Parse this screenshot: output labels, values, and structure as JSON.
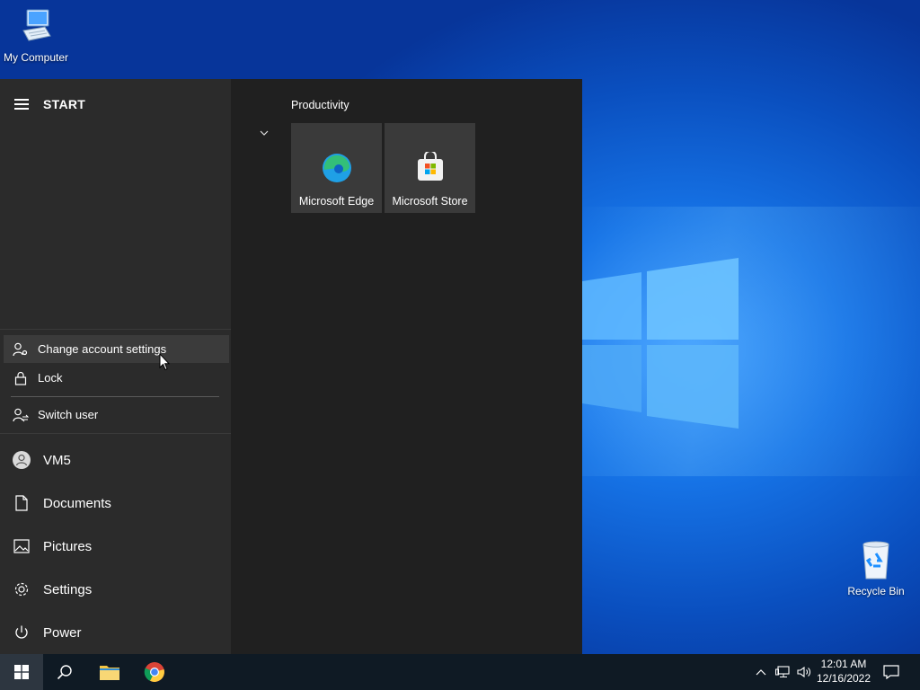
{
  "desktop": {
    "my_computer_label": "My Computer",
    "recycle_bin_label": "Recycle Bin"
  },
  "start_menu": {
    "title": "START",
    "account_flyout": {
      "items": [
        {
          "label": "Change account settings",
          "icon": "account-settings-icon"
        },
        {
          "label": "Lock",
          "icon": "lock-icon"
        },
        {
          "label": "Switch user",
          "icon": "switch-user-icon"
        }
      ]
    },
    "rail": [
      {
        "label": "VM5",
        "icon": "avatar-icon"
      },
      {
        "label": "Documents",
        "icon": "document-icon"
      },
      {
        "label": "Pictures",
        "icon": "pictures-icon"
      },
      {
        "label": "Settings",
        "icon": "gear-icon"
      },
      {
        "label": "Power",
        "icon": "power-icon"
      }
    ],
    "group": {
      "title": "Productivity",
      "tiles": [
        {
          "label": "Microsoft Edge",
          "icon": "edge-icon"
        },
        {
          "label": "Microsoft Store",
          "icon": "store-icon"
        }
      ]
    }
  },
  "taskbar": {
    "apps": [
      {
        "name": "Search",
        "icon": "search-icon"
      },
      {
        "name": "File Explorer",
        "icon": "folder-icon"
      },
      {
        "name": "Google Chrome",
        "icon": "chrome-icon"
      }
    ],
    "clock": {
      "time": "12:01 AM",
      "date": "12/16/2022"
    }
  },
  "colors": {
    "start_bg": "#202020",
    "rail_bg": "#2b2b2b",
    "tile_bg": "#3a3a3a",
    "taskbar_bg": "#0f1a24",
    "desktop_accent": "#1673e6"
  }
}
